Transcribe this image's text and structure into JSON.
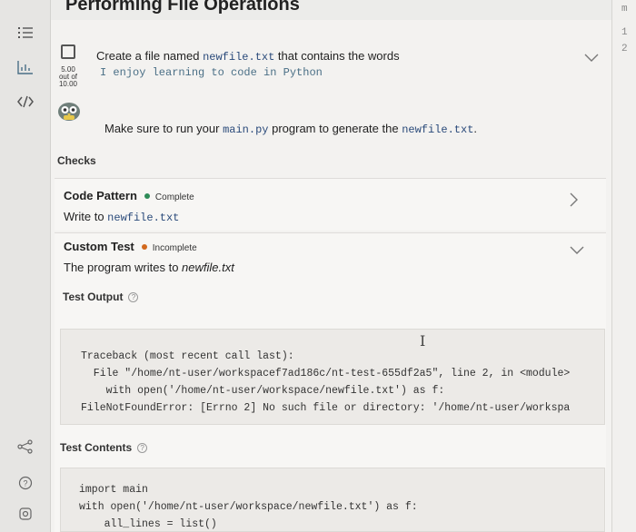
{
  "header": {
    "title": "Performing File Operations"
  },
  "right_strip": {
    "top_char": "m",
    "line_numbers": [
      "1",
      "2"
    ]
  },
  "task": {
    "score": {
      "value": "5.00",
      "sep": "out of",
      "total": "10.00"
    },
    "line1_prefix": "Create a file named ",
    "line1_code": "newfile.txt",
    "line1_suffix": " that contains the words",
    "line2": "I enjoy learning to code in Python",
    "line3_prefix": "Make sure to run your ",
    "line3_code1": "main.py",
    "line3_mid": " program to generate the ",
    "line3_code2": "newfile.txt",
    "line3_suffix": "."
  },
  "checks": {
    "label": "Checks",
    "items": [
      {
        "name": "Code Pattern",
        "status": "Complete",
        "status_color": "#2e8b57",
        "desc_prefix": "Write to ",
        "desc_code": "newfile.txt"
      },
      {
        "name": "Custom Test",
        "status": "Incomplete",
        "status_color": "#d2691e",
        "desc": "The program writes to ",
        "desc_italic": "newfile.txt"
      }
    ]
  },
  "test_output": {
    "label": "Test Output",
    "help": "?",
    "lines": [
      "Traceback (most recent call last):",
      "  File \"/home/nt-user/workspacef7ad186c/nt-test-655df2a5\", line 2, in <module>",
      "    with open('/home/nt-user/workspace/newfile.txt') as f:",
      "FileNotFoundError: [Errno 2] No such file or directory: '/home/nt-user/workspa"
    ]
  },
  "test_contents": {
    "label": "Test Contents",
    "help": "?",
    "lines": [
      "import main",
      "with open('/home/nt-user/workspace/newfile.txt') as f:",
      "    all_lines = list()"
    ]
  },
  "colors": {
    "accent": "#2a4a7a",
    "complete": "#2e8b57",
    "incomplete": "#d2691e"
  },
  "icons": [
    "list-icon",
    "chart-icon",
    "code-icon",
    "share-icon",
    "help-icon",
    "settings-icon",
    "owl-icon",
    "chevron-down-icon",
    "chevron-right-icon"
  ]
}
